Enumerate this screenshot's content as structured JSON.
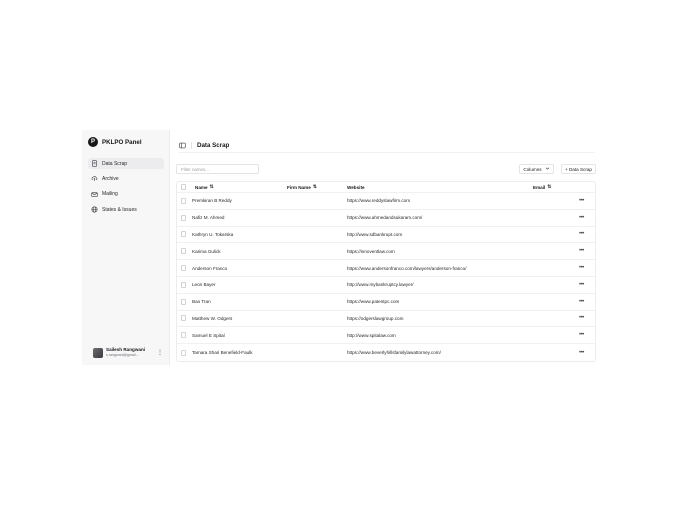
{
  "sidebar": {
    "brand": {
      "badge": "P",
      "name": "PKLPO Panel"
    },
    "items": [
      {
        "label": "Data Scrap",
        "icon": "document-icon",
        "active": true
      },
      {
        "label": "Archive",
        "icon": "cloud-upload-icon",
        "active": false
      },
      {
        "label": "Mailing",
        "icon": "mail-icon",
        "active": false
      },
      {
        "label": "States & Issues",
        "icon": "globe-icon",
        "active": false
      }
    ],
    "user": {
      "name": "Sailesh Rangwani",
      "email": "s.rangwani@gmail..."
    }
  },
  "header": {
    "title": "Data Scrap"
  },
  "toolbar": {
    "filter_placeholder": "Filter names...",
    "columns_label": "Columns",
    "add_label": "+ Data Scrap"
  },
  "table": {
    "columns": {
      "name": "Name",
      "firm": "Firm Name",
      "website": "Website",
      "email": "Email"
    },
    "sort_glyph": "⇅",
    "more_glyph": "•••",
    "rows": [
      {
        "name": "Premkiran B Reddy",
        "firm": "",
        "website": "https://www.reddyslawfirm.com",
        "email": ""
      },
      {
        "name": "Nafiz M. Ahmed",
        "firm": "",
        "website": "https://www.ahmedandsukaram.com/",
        "email": ""
      },
      {
        "name": "Kathryn U. Tokarska",
        "firm": "",
        "website": "http://www.sdbankrupt.com",
        "email": ""
      },
      {
        "name": "Karima Gulick",
        "firm": "",
        "website": "https://innoventlaw.com",
        "email": ""
      },
      {
        "name": "Anderson Franco",
        "firm": "",
        "website": "https://www.andersonfranco.com/lawyers/anderson-franco/",
        "email": ""
      },
      {
        "name": "Leon Bayer",
        "firm": "",
        "website": "http://www.mybankruptcy.lawyer/",
        "email": ""
      },
      {
        "name": "Bao Tran",
        "firm": "",
        "website": "https://www.patentpc.com",
        "email": ""
      },
      {
        "name": "Matthew W. Odgers",
        "firm": "",
        "website": "https://odgerslawgroup.com",
        "email": ""
      },
      {
        "name": "Samuel E Spital",
        "firm": "",
        "website": "http://www.spitalaw.com",
        "email": ""
      },
      {
        "name": "Tamara Shari Benefield-Faulk",
        "firm": "",
        "website": "https://www.beverlyhillsfamilylawattorney.com/",
        "email": ""
      }
    ]
  }
}
